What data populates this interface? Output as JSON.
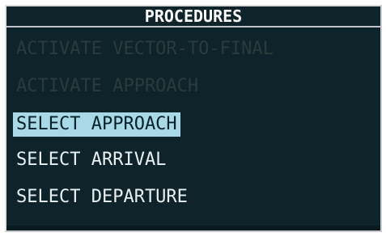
{
  "window": {
    "title": "PROCEDURES"
  },
  "menu": {
    "items": [
      {
        "label": "ACTIVATE VECTOR-TO-FINAL",
        "state": "disabled"
      },
      {
        "label": "ACTIVATE APPROACH",
        "state": "disabled"
      },
      {
        "label": "SELECT APPROACH",
        "state": "selected"
      },
      {
        "label": "SELECT ARRIVAL",
        "state": "enabled"
      },
      {
        "label": "SELECT DEPARTURE",
        "state": "enabled"
      }
    ]
  },
  "colors": {
    "background": "#0f232a",
    "selected_highlight": "#a9d8e6",
    "enabled_text": "#e8f0f2",
    "disabled_text": "#2a3b3c",
    "border": "#c8ccce"
  }
}
